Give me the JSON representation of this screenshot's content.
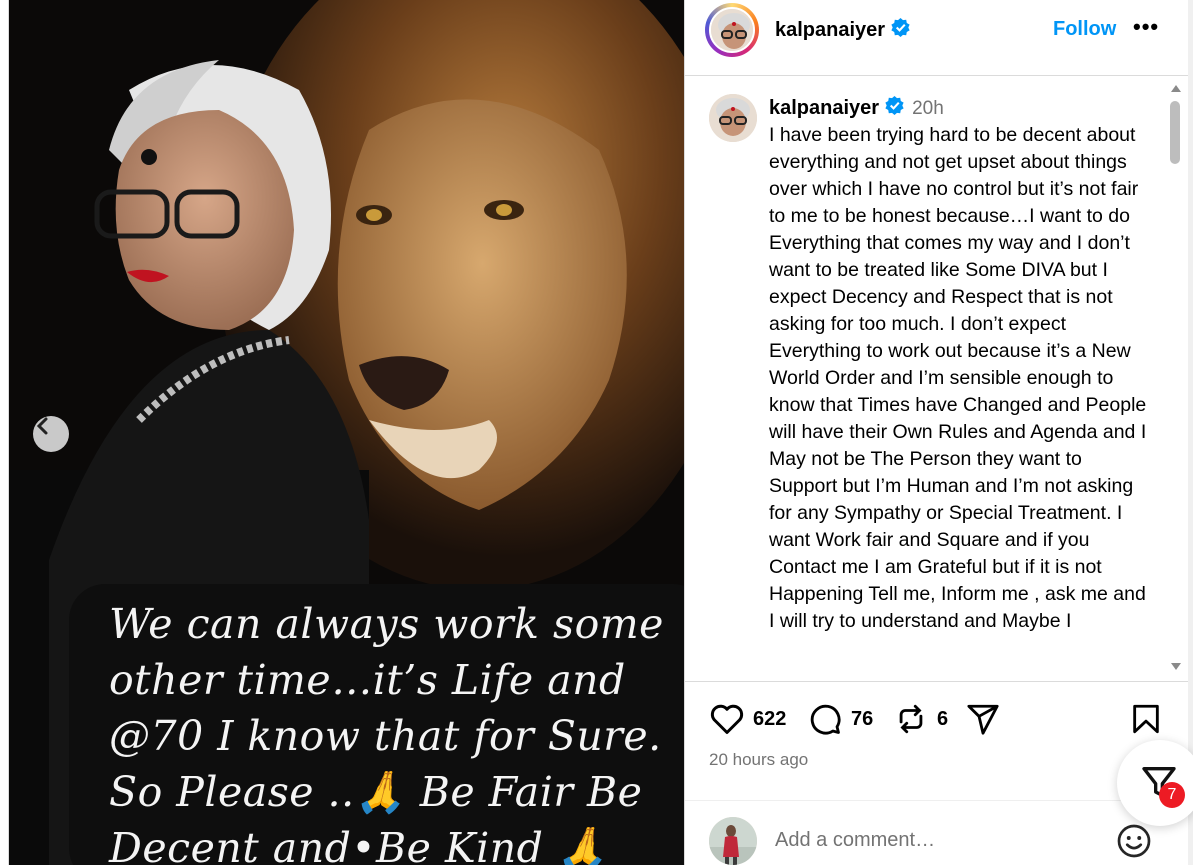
{
  "post": {
    "username": "kalpanaiyer",
    "follow_label": "Follow",
    "more_label": "•••",
    "relative_time": "20h",
    "caption_image_text": "We can always work some\nother time…it’s Life and\n@70 I know that for Sure.\nSo Please ..🙏 Be Fair Be\nDecent and•Be Kind 🙏",
    "body_text": "I have been trying hard to be decent about everything and not get upset about things over which I have no control but it’s not fair to me to be honest because…I want to do Everything that comes my way and I don’t want to be treated like Some DIVA but I expect Decency and Respect that is not asking for too much. I don’t expect Everything to work out because it’s a New World Order and I’m sensible enough to know that Times have Changed and People will have their Own Rules and Agenda and I May not be The Person they want to Support but I’m Human and I’m not asking for any Sympathy or Special Treatment. I want Work fair and Square and if you Contact me I am Grateful but if it is not Happening Tell me, Inform me , ask me and I will try to understand and Maybe I",
    "likes": "622",
    "comments": "76",
    "reposts": "6",
    "timestamp": "20 hours ago",
    "comment_placeholder": "Add a comment…",
    "notification_count": "7"
  },
  "icons": {
    "verified": "verified-badge-icon",
    "like": "heart-icon",
    "comment": "comment-bubble-icon",
    "repost": "repost-icon",
    "share": "send-icon",
    "save": "bookmark-icon",
    "emoji": "emoji-icon",
    "prev": "chevron-left-icon",
    "filter": "filter-icon"
  },
  "colors": {
    "accent": "#0095f6",
    "verified": "#0095f6",
    "badge": "#ed1b24"
  }
}
